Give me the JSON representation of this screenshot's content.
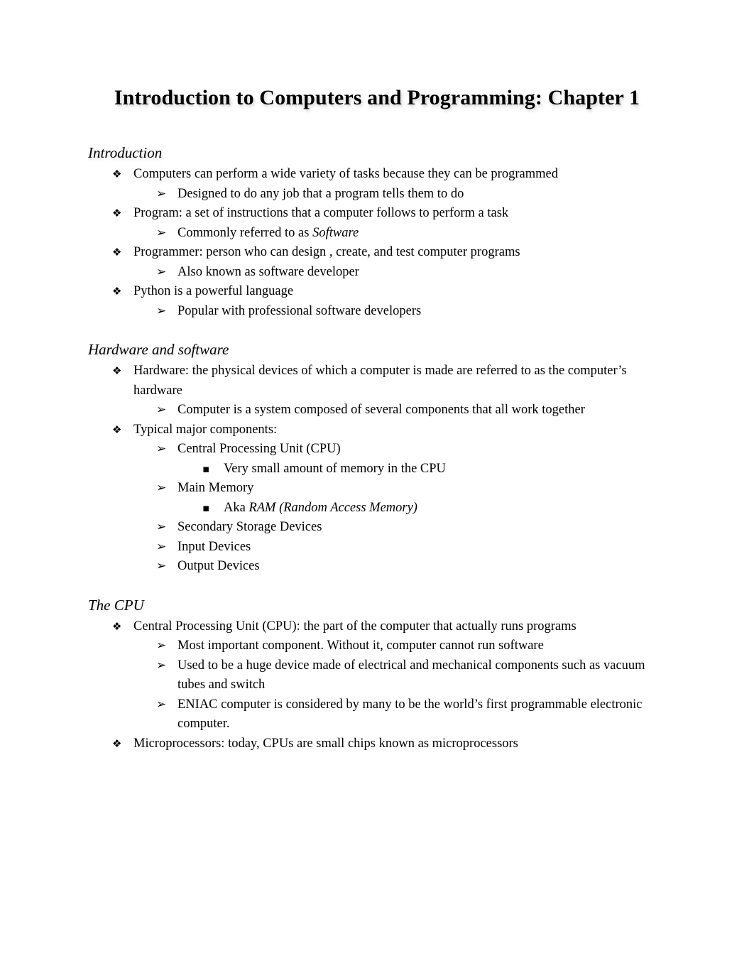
{
  "document": {
    "title": "Introduction to Computers and Programming: Chapter 1"
  },
  "bullet_glyphs": {
    "level1": "❖",
    "level2": "➢",
    "level3": "▪"
  },
  "sections": [
    {
      "heading": "Introduction",
      "items": [
        {
          "level": 1,
          "text": "Computers can perform a wide variety of tasks because they can be programmed"
        },
        {
          "level": 2,
          "text": "Designed to do any job that a program tells them to do"
        },
        {
          "level": 1,
          "text": "Program: a set of instructions that a computer follows to perform a task"
        },
        {
          "level": 2,
          "text": "Commonly referred to as ",
          "italic_tail": "Software"
        },
        {
          "level": 1,
          "text": "Programmer: person who can design , create, and test computer programs"
        },
        {
          "level": 2,
          "text": "Also known as software developer"
        },
        {
          "level": 1,
          "text": "Python is a powerful language"
        },
        {
          "level": 2,
          "text": "Popular with professional software developers"
        }
      ]
    },
    {
      "heading": "Hardware and software",
      "items": [
        {
          "level": 1,
          "text": "Hardware: the physical devices of which a computer is made are referred to as the computer’s hardware"
        },
        {
          "level": 2,
          "text": "Computer is a system composed of several components that all work together"
        },
        {
          "level": 1,
          "text": "Typical major components:"
        },
        {
          "level": 2,
          "text": "Central Processing Unit (CPU)"
        },
        {
          "level": 3,
          "text": "Very small amount of memory in the CPU"
        },
        {
          "level": 2,
          "text": "Main Memory"
        },
        {
          "level": 3,
          "text": "Aka ",
          "italic_tail": "RAM (Random Access Memory)"
        },
        {
          "level": 2,
          "text": "Secondary Storage Devices"
        },
        {
          "level": 2,
          "text": "Input Devices"
        },
        {
          "level": 2,
          "text": "Output Devices"
        }
      ]
    },
    {
      "heading": "The CPU",
      "items": [
        {
          "level": 1,
          "text": "Central Processing Unit (CPU): the part of the computer that actually runs programs"
        },
        {
          "level": 2,
          "text": "Most important component. Without it, computer cannot run software"
        },
        {
          "level": 2,
          "text": "Used to be a huge device made of electrical and mechanical components such as vacuum tubes and switch"
        },
        {
          "level": 2,
          "text": "ENIAC computer is considered by many to be the world’s first programmable electronic computer."
        },
        {
          "level": 1,
          "text": "Microprocessors: today, CPUs are small chips known as microprocessors"
        }
      ]
    }
  ]
}
